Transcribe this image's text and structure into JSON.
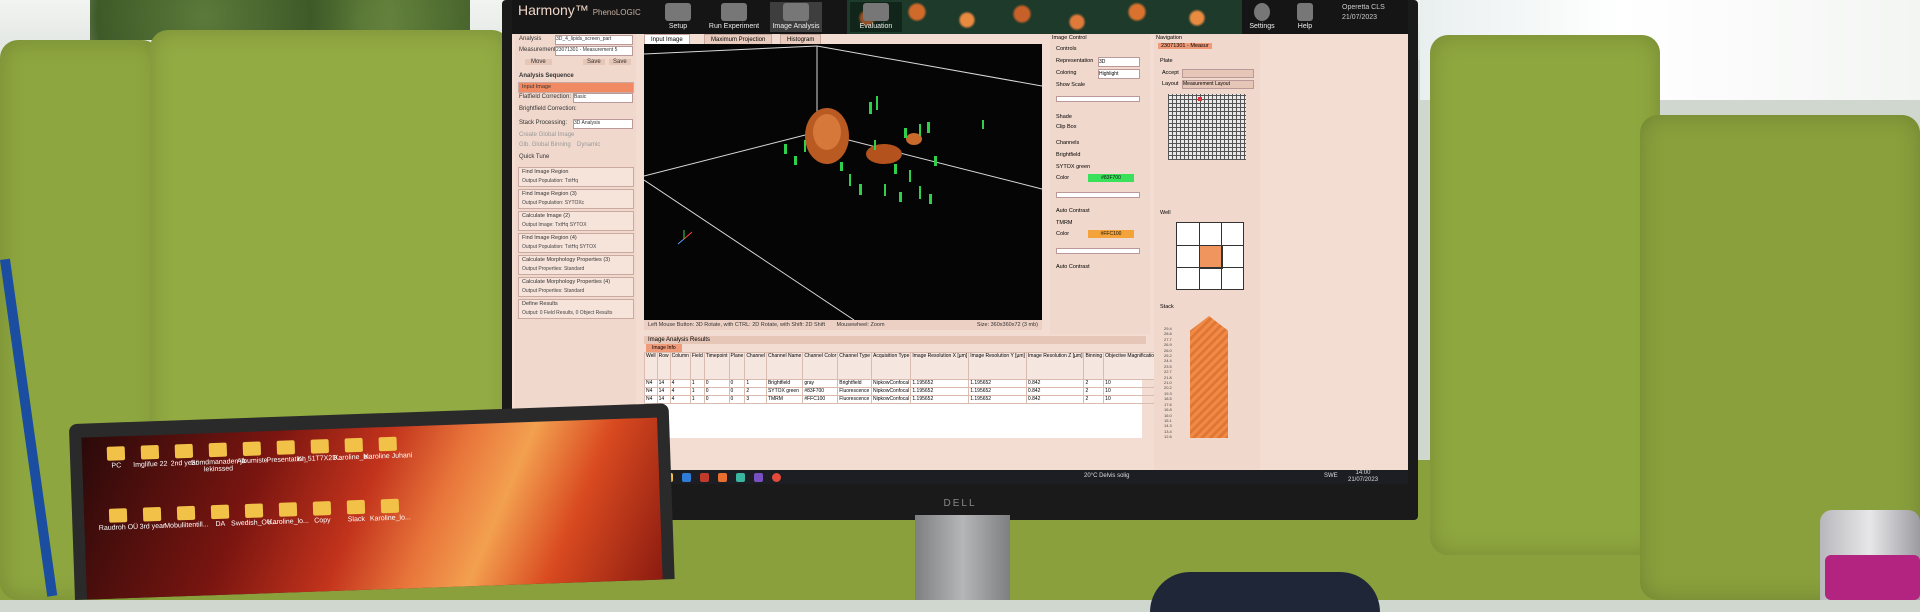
{
  "app": {
    "brand": "Harmony",
    "brand_sub": "PhenoLOGIC",
    "toolbar": [
      "Setup",
      "Run Experiment",
      "Image Analysis",
      "Evaluation",
      "Settings",
      "Help"
    ],
    "user_lines": [
      "Operetta CLS",
      "21/07/2023"
    ],
    "analysis_label": "Analysis",
    "analysis_value": "3D_4_lipids_screen_part",
    "measurement_label": "Measurement",
    "measurement_value": "23071301 - Measurement 5",
    "buttons": [
      "Move",
      "Save",
      "Save"
    ]
  },
  "sequence": {
    "header": "Analysis Sequence",
    "input_image": "Input Image",
    "flatfield_label": "Flatfield Correction:",
    "flatfield_value": "Basic",
    "brightfield_label": "Brightfield Correction:",
    "stack_label": "Stack Processing:",
    "stack_value": "3D Analysis",
    "global_image": "Create Global Image",
    "global_binning": "Glb. Global Binning",
    "dynamic": "Dynamic",
    "quick_tune": "Quick Tune",
    "blocks": [
      {
        "title": "Find Image Region",
        "output": "Output Population:  TxtHq"
      },
      {
        "title": "Find Image Region (3)",
        "output": "Output Population:  SYTOXc"
      },
      {
        "title": "Calculate Image (2)",
        "output": "Output Image:  TxtHq SYTOX"
      },
      {
        "title": "Find Image Region (4)",
        "output": "Output Population:  TxtHq SYTOX"
      },
      {
        "title": "Calculate Morphology Properties (3)",
        "output": "Output Properties:  Standard"
      },
      {
        "title": "Calculate Morphology Properties (4)",
        "output": "Output Properties:  Standard"
      },
      {
        "title": "Define Results",
        "output": "Output:  0 Field Results, 0 Object Results"
      }
    ]
  },
  "viewer": {
    "tabs": [
      "Input Image",
      "Maximum Projection",
      "Histogram"
    ],
    "hint": "Left Mouse Button: 3D Rotate, with CTRL: 2D Rotate, with Shift: 2D Shift",
    "hint2": "Mousewheel: Zoom",
    "size": "Size: 360x360x72 (3 mb)"
  },
  "results": {
    "header": "Image Analysis Results",
    "subtab": "Image Info",
    "columns": [
      "Well",
      "Row",
      "Column",
      "Field",
      "Timepoint",
      "Plane",
      "Channel",
      "Channel Name",
      "Channel Color",
      "Channel Type",
      "Acquisition Type",
      "Image Resolution X [µm]",
      "Image Resolution Y [µm]",
      "Image Resolution Z [µm]",
      "Binning",
      "Objective Magnification",
      "Main Emission Wavelength [nm]",
      "Main Exc"
    ],
    "rows": [
      [
        "N4",
        "14",
        "4",
        "1",
        "0",
        "0",
        "1",
        "Brightfield",
        "gray",
        "Brightfield",
        "NipkowConfocal",
        "1.195652",
        "1.195652",
        "0.842",
        "2",
        "10",
        "5",
        "740"
      ],
      [
        "N4",
        "14",
        "4",
        "1",
        "0",
        "0",
        "2",
        "SYTOX green",
        "#83F700",
        "Fluorescence",
        "NipkowConfocal",
        "1.195652",
        "1.195652",
        "0.842",
        "2",
        "10",
        "522",
        "488"
      ],
      [
        "N4",
        "14",
        "4",
        "1",
        "0",
        "0",
        "3",
        "TMRM",
        "#FFC100",
        "Fluorescence",
        "NipkowConfocal",
        "1.195652",
        "1.195652",
        "0.842",
        "2",
        "10",
        "599",
        "561"
      ]
    ]
  },
  "image_control": {
    "header": "Image Control",
    "controls": "Controls",
    "representation": "Representation",
    "representation_value": "3D",
    "coloring": "Coloring",
    "coloring_value": "Highlight",
    "show_scale": "Show Scale",
    "shade": "Shade",
    "clip_box": "Clip Box",
    "channels": "Channels",
    "ch1": "Brightfield",
    "ch2": "SYTOX green",
    "color_label": "Color",
    "ch2_color": "#83F700",
    "auto_contrast": "Auto Contrast",
    "ch3": "TMRM",
    "ch3_color": "#FFC100",
    "colors": {
      "green": "#39e05a",
      "orange": "#f3a33a"
    }
  },
  "navigation": {
    "header": "Navigation",
    "plate_tab": "23071301 - Measur",
    "plate": "Plate",
    "accept": "Accept",
    "layout_label": "Layout",
    "layout_value": "Measurement Layout",
    "well": "Well",
    "stack": "Stack",
    "stack_ticks": [
      "29.4",
      "28.6",
      "27.7",
      "26.9",
      "26.0",
      "25.2",
      "24.4",
      "23.5",
      "22.7",
      "21.8",
      "21.0",
      "20.2",
      "19.3",
      "18.5",
      "17.6",
      "16.8",
      "16.0",
      "15.1",
      "14.3",
      "13.4",
      "12.6"
    ]
  },
  "taskbar": {
    "weather": "20°C  Delvis solig",
    "lang": "SWE",
    "time": "14:00",
    "date": "21/07/2023"
  },
  "laptop": {
    "icons": [
      "PC",
      "Imglifue 22",
      "2nd year",
      "Sömdmanaden ja lekinssed",
      "Albumiste",
      "Presentation",
      "KI_51T7X2D...",
      "Karoline_bi...",
      "Karoline Juhani",
      "Raudroh OÜ",
      "3rd year",
      "Mobuliitentill...",
      "DA",
      "Swedish_OU...",
      "Karoline_lo...",
      "Copy",
      "Slack",
      "Karoline_lo..."
    ]
  }
}
